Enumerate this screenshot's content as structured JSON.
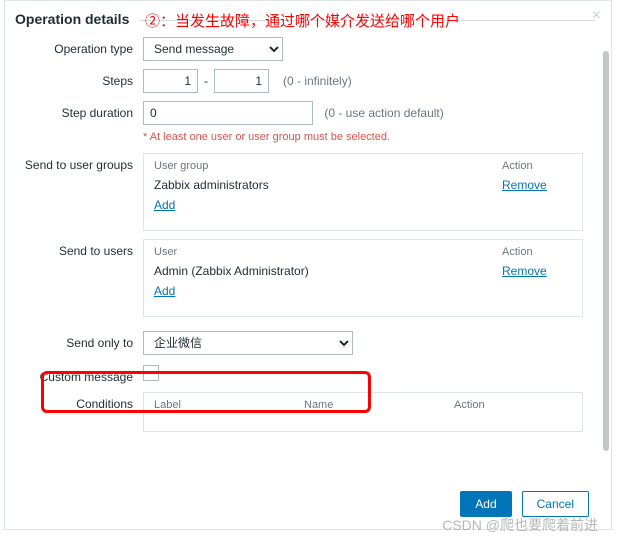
{
  "annotation": "②：当发生故障，通过哪个媒介发送给哪个用户",
  "title": "Operation details",
  "close_label": "×",
  "labels": {
    "operation_type": "Operation type",
    "steps": "Steps",
    "step_duration": "Step duration",
    "send_to_user_groups": "Send to user groups",
    "send_to_users": "Send to users",
    "send_only_to": "Send only to",
    "custom_message": "Custom message",
    "conditions": "Conditions"
  },
  "operation_type": {
    "value": "Send message"
  },
  "steps": {
    "from": "1",
    "to": "1",
    "hint": "(0 - infinitely)"
  },
  "step_duration": {
    "value": "0",
    "hint": "(0 - use action default)"
  },
  "required_note": "At least one user or user group must be selected.",
  "user_groups": {
    "head_main": "User group",
    "head_action": "Action",
    "rows": [
      {
        "name": "Zabbix administrators",
        "action": "Remove"
      }
    ],
    "add": "Add"
  },
  "users": {
    "head_main": "User",
    "head_action": "Action",
    "rows": [
      {
        "name": "Admin (Zabbix Administrator)",
        "action": "Remove"
      }
    ],
    "add": "Add"
  },
  "send_only_to": {
    "value": "企业微信"
  },
  "conditions": {
    "head_label": "Label",
    "head_name": "Name",
    "head_action": "Action"
  },
  "buttons": {
    "add": "Add",
    "cancel": "Cancel"
  },
  "watermark": "CSDN @爬也要爬着前进"
}
